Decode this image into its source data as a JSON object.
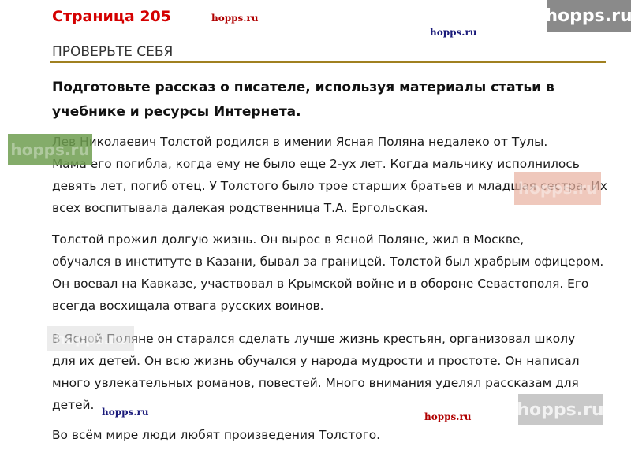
{
  "header": {
    "page_number": "Страница 205",
    "section_title": "ПРОВЕРЬТЕ СЕБЯ"
  },
  "watermarks": {
    "small": "hopps.ru",
    "box": "hopps.ru",
    "colors": {
      "box_top_right": "#8a8a8a",
      "box_left": "#6e9e50",
      "box_middle_right": "#e8b8a8",
      "box_bottom_right": "#c8c8c8",
      "accent_red": "#d40000"
    }
  },
  "task": {
    "lines": [
      "Подготовьте рассказ о писателе, используя материалы статьи в",
      "учебнике и ресурсы Интернета."
    ]
  },
  "paragraphs": [
    {
      "lines": [
        "Лев Николаевич Толстой родился в имении Ясная Поляна недалеко от Тулы.",
        "Мама его погибла, когда ему не было еще 2-ух лет. Когда мальчику исполнилось",
        "девять лет, погиб отец. У Толстого было трое старших братьев и младшая сестра. Их",
        "всех воспитывала далекая родственница Т.А. Ергольская."
      ]
    },
    {
      "lines": [
        "Толстой прожил долгую жизнь. Он вырос в Ясной Поляне, жил в Москве,",
        "обучался в институте в Казани, бывал за границей. Толстой был храбрым офицером.",
        "Он воевал на Кавказе, участвовал в Крымской войне и в обороне Севастополя. Его",
        "всегда восхищала отвага русских воинов."
      ]
    },
    {
      "lines": [
        "В Ясной Поляне он старался сделать лучше жизнь крестьян, организовал школу",
        "для их детей. Он всю жизнь обучался у народа мудрости и простоте. Он написал",
        "много увлекательных романов, повестей. Много внимания уделял рассказам для",
        "детей."
      ]
    },
    {
      "lines": [
        "Во всём мире люди любят произведения Толстого."
      ]
    }
  ]
}
